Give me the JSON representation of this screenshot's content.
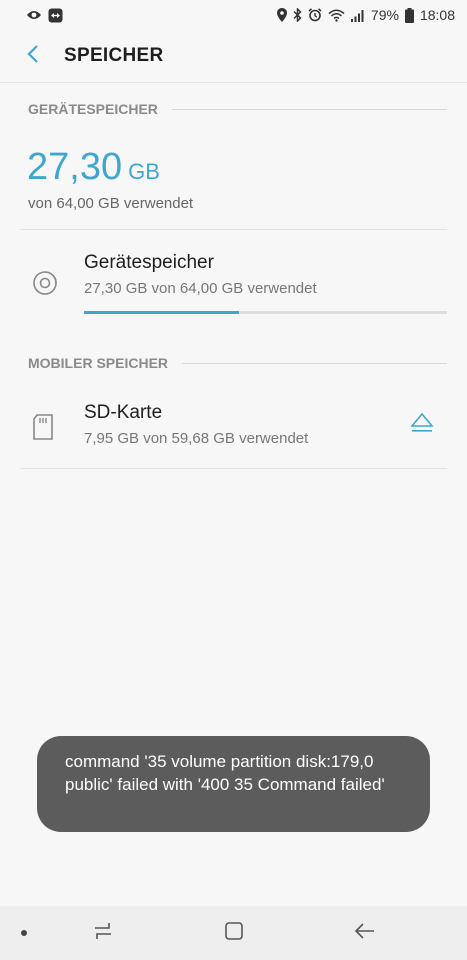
{
  "status_bar": {
    "battery": "79%",
    "time": "18:08",
    "left_icons": [
      "eye-icon",
      "teamviewer-icon"
    ],
    "right_icons": [
      "location-icon",
      "bluetooth-icon",
      "alarm-icon",
      "wifi-icon",
      "signal-icon",
      "battery-icon"
    ]
  },
  "app_bar": {
    "title": "SPEICHER",
    "back_icon": "back-arrow-icon"
  },
  "device_storage": {
    "section_header": "GERÄTESPEICHER",
    "used_value": "27,30",
    "used_unit": "GB",
    "used_summary": "von 64,00 GB verwendet",
    "item": {
      "title": "Gerätespeicher",
      "subtitle": "27,30 GB von 64,00 GB verwendet",
      "progress_fraction": 0.427,
      "icon": "storage-disc-icon"
    }
  },
  "mobile_storage": {
    "section_header": "MOBILER SPEICHER",
    "item": {
      "title": "SD-Karte",
      "subtitle": "7,95 GB von 59,68 GB verwendet",
      "icon": "sd-card-icon",
      "action_icon": "eject-icon"
    }
  },
  "toast": {
    "message": "command '35 volume partition disk:179,0 public' failed with '400 35 Command failed'"
  },
  "nav_bar": {
    "buttons": [
      "recents-icon",
      "home-icon",
      "back-icon"
    ]
  },
  "colors": {
    "accent": "#3fa7cf",
    "background": "#f7f7f7",
    "toast_bg": "#5c5c5c"
  }
}
